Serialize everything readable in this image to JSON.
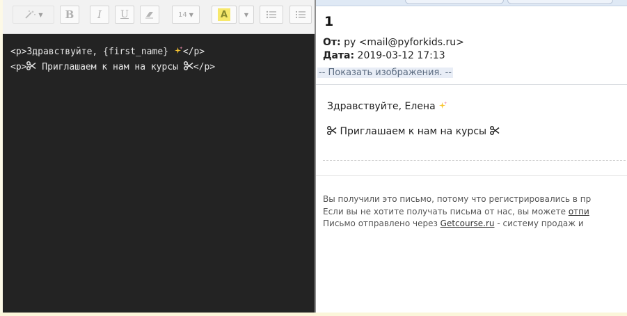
{
  "toolbar": {
    "magic_tool": "magic-wand",
    "bold_label": "B",
    "italic_label": "I",
    "underline_label": "U",
    "font_size": "14",
    "color_label": "A",
    "accent_color": "#f7e86c"
  },
  "editor": {
    "lines": [
      {
        "prefix": "<p>Здравствуйте, {first_name} ",
        "suffix": "</p>"
      },
      {
        "prefix": "<p>",
        "middle": " Приглашаем к нам на курсы ",
        "suffix": "</p>"
      }
    ]
  },
  "email": {
    "subject": "1",
    "from_label": "От:",
    "from_value": "ру <mail@pyforkids.ru>",
    "date_label": "Дата:",
    "date_value": "2019-03-12 17:13",
    "show_images": "-- Показать изображения. --",
    "greeting": "Здравствуйте, Елена ",
    "invite": " Приглашаем к нам на курсы ",
    "footer": {
      "line1": "Вы получили это письмо, потому что регистрировались в пр",
      "line2_text": "Если вы не хотите получать письма от нас, вы можете ",
      "line2_link": "отпи",
      "line3_text": "Письмо отправлено через ",
      "line3_link": "Getcourse.ru",
      "line3_rest": " - систему продаж и"
    }
  }
}
